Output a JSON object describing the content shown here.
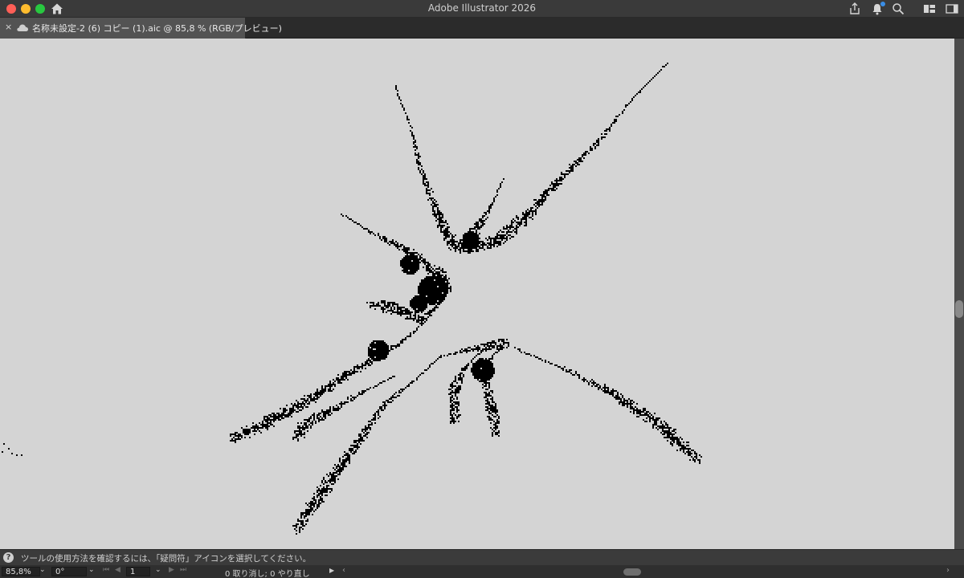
{
  "window": {
    "title": "Adobe Illustrator 2026"
  },
  "titlebar_icons": [
    "home-icon",
    "share-icon",
    "bell-icon",
    "search-icon",
    "workspace-icon",
    "panel-layout-icon"
  ],
  "document_tab": {
    "close_label": "×",
    "cloud_icon": "cloud-icon",
    "title": "名称未設定-2 (6) コピー (1).aic @ 85,8 % (RGB/プレビュー)"
  },
  "canvas": {
    "background": "#d4d4d4",
    "artwork": "black halftone dotted starburst spikes"
  },
  "hint_bar": {
    "icon": "help-icon",
    "text": "ツールの使用方法を確認するには、「疑問符」アイコンを選択してください。"
  },
  "status_bar": {
    "zoom": "85,8%",
    "rotation": "0°",
    "artboard": "1",
    "undo_status": "0 取り消し; 0 やり直し"
  },
  "colors": {
    "close": "#ff5f57",
    "minimize": "#febc2e",
    "maximize": "#28c840",
    "notification": "#3a8ee6",
    "artwork": "#000000"
  }
}
